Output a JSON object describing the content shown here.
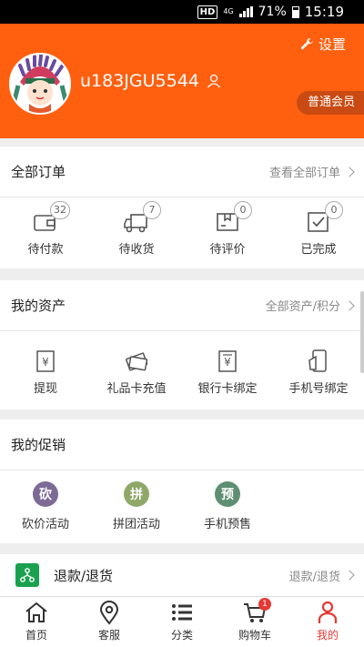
{
  "status_bar": {
    "hd": "HD",
    "network": "4G",
    "battery": "71%",
    "time": "15:19"
  },
  "header": {
    "settings_label": "设置",
    "username": "u183JGU5544",
    "member_level": "普通会员"
  },
  "orders": {
    "title": "全部订单",
    "more": "查看全部订单",
    "items": [
      {
        "label": "待付款",
        "count": "32",
        "icon": "wallet-icon"
      },
      {
        "label": "待收货",
        "count": "7",
        "icon": "truck-icon"
      },
      {
        "label": "待评价",
        "count": "0",
        "icon": "package-icon"
      },
      {
        "label": "已完成",
        "count": "0",
        "icon": "check-box-icon"
      }
    ]
  },
  "assets": {
    "title": "我的资产",
    "more": "全部资产/积分",
    "items": [
      {
        "label": "提现",
        "icon": "withdraw-icon"
      },
      {
        "label": "礼品卡充值",
        "icon": "gift-card-icon"
      },
      {
        "label": "银行卡绑定",
        "icon": "bank-card-icon"
      },
      {
        "label": "手机号绑定",
        "icon": "phone-icon"
      }
    ]
  },
  "promotions": {
    "title": "我的促销",
    "items": [
      {
        "label": "砍价活动",
        "glyph": "砍",
        "color": "#7d6b96"
      },
      {
        "label": "拼团活动",
        "glyph": "拼",
        "color": "#8fa86a"
      },
      {
        "label": "手机预售",
        "glyph": "预",
        "color": "#5f8f72"
      }
    ]
  },
  "refund": {
    "label": "退款/退货",
    "more": "退款/退货"
  },
  "bottom_nav": {
    "items": [
      {
        "label": "首页",
        "icon": "home-icon"
      },
      {
        "label": "客服",
        "icon": "location-pin-icon"
      },
      {
        "label": "分类",
        "icon": "list-icon"
      },
      {
        "label": "购物车",
        "icon": "cart-icon",
        "badge": "1"
      },
      {
        "label": "我的",
        "icon": "person-icon",
        "active": true
      }
    ]
  },
  "colors": {
    "brand": "#ff6010",
    "member_bg": "#c94a12",
    "active": "#e53935",
    "refund_icon": "#1aa14f"
  }
}
